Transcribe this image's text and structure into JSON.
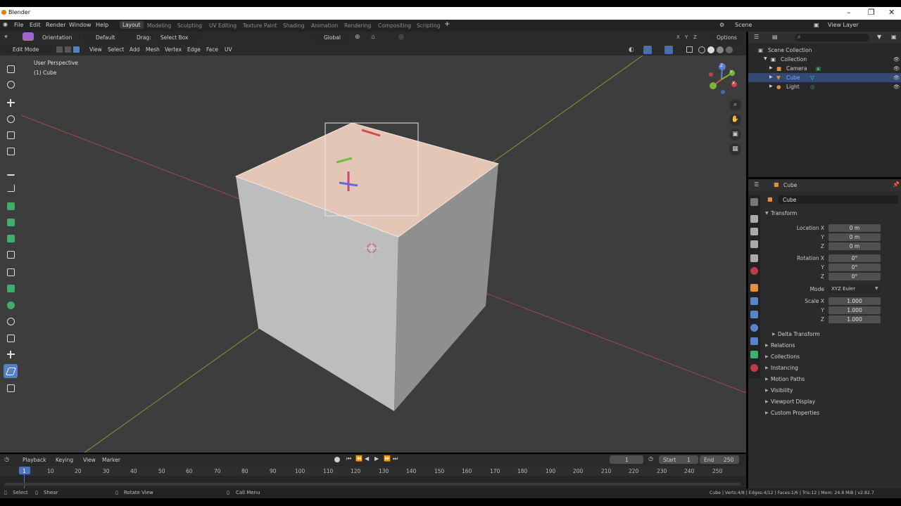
{
  "window": {
    "title": "Blender"
  },
  "menus": [
    "File",
    "Edit",
    "Render",
    "Window",
    "Help"
  ],
  "workspaces": [
    "Layout",
    "Modeling",
    "Sculpting",
    "UV Editing",
    "Texture Paint",
    "Shading",
    "Animation",
    "Rendering",
    "Compositing",
    "Scripting"
  ],
  "active_workspace": "Layout",
  "scene": {
    "label": "Scene",
    "view_layer": "View Layer"
  },
  "tool_header": {
    "orientation_label": "Orientation",
    "orientation_value": "Default",
    "drag_label": "Drag:",
    "drag_value": "Select Box",
    "transform_orientation": "Global",
    "options": "Options"
  },
  "viewport_header": {
    "mode": "Edit Mode",
    "menus": [
      "View",
      "Select",
      "Add",
      "Mesh",
      "Vertex",
      "Edge",
      "Face",
      "UV"
    ]
  },
  "viewport": {
    "perspective": "User Perspective",
    "object_info": "(1) Cube",
    "axis_labels": {
      "z": "Z",
      "y": "Y",
      "x": "X"
    }
  },
  "outliner": {
    "root": "Scene Collection",
    "items": [
      {
        "label": "Collection",
        "selected": false
      },
      {
        "label": "Camera",
        "selected": false
      },
      {
        "label": "Cube",
        "selected": true
      },
      {
        "label": "Light",
        "selected": false
      }
    ]
  },
  "properties": {
    "header_object": "Cube",
    "object_name": "Cube",
    "transform_title": "Transform",
    "location": {
      "label_x": "Location X",
      "x": "0 m",
      "y": "0 m",
      "z": "0 m"
    },
    "rotation": {
      "label_x": "Rotation X",
      "x": "0°",
      "y": "0°",
      "z": "0°"
    },
    "mode_label": "Mode",
    "mode_value": "XYZ Euler",
    "scale": {
      "label_x": "Scale X",
      "x": "1.000",
      "y": "1.000",
      "z": "1.000"
    },
    "axis_y": "Y",
    "axis_z": "Z",
    "delta_transform": "Delta Transform",
    "sections": [
      "Relations",
      "Collections",
      "Instancing",
      "Motion Paths",
      "Visibility",
      "Viewport Display",
      "Custom Properties"
    ]
  },
  "timeline": {
    "menus": [
      "Playback",
      "Keying",
      "View",
      "Marker"
    ],
    "current_frame": "1",
    "start_label": "Start",
    "start": "1",
    "end_label": "End",
    "end": "250",
    "ticks": [
      "1",
      "10",
      "20",
      "30",
      "40",
      "50",
      "60",
      "70",
      "80",
      "90",
      "100",
      "110",
      "120",
      "130",
      "140",
      "150",
      "160",
      "170",
      "180",
      "190",
      "200",
      "210",
      "220",
      "230",
      "240",
      "250"
    ]
  },
  "statusbar": {
    "select": "Select",
    "shear": "Shear",
    "rotate_view": "Rotate View",
    "call_menu": "Call Menu",
    "stats": "Cube | Verts:4/8 | Edges:4/12 | Faces:1/6 | Tris:12 | Mem: 24.8 MiB | v2.82.7"
  },
  "colors": {
    "accent": "#5680c2",
    "selected_face": "#e8c8b8",
    "x_axis": "#b84a4a",
    "y_axis": "#7a9a3a"
  }
}
